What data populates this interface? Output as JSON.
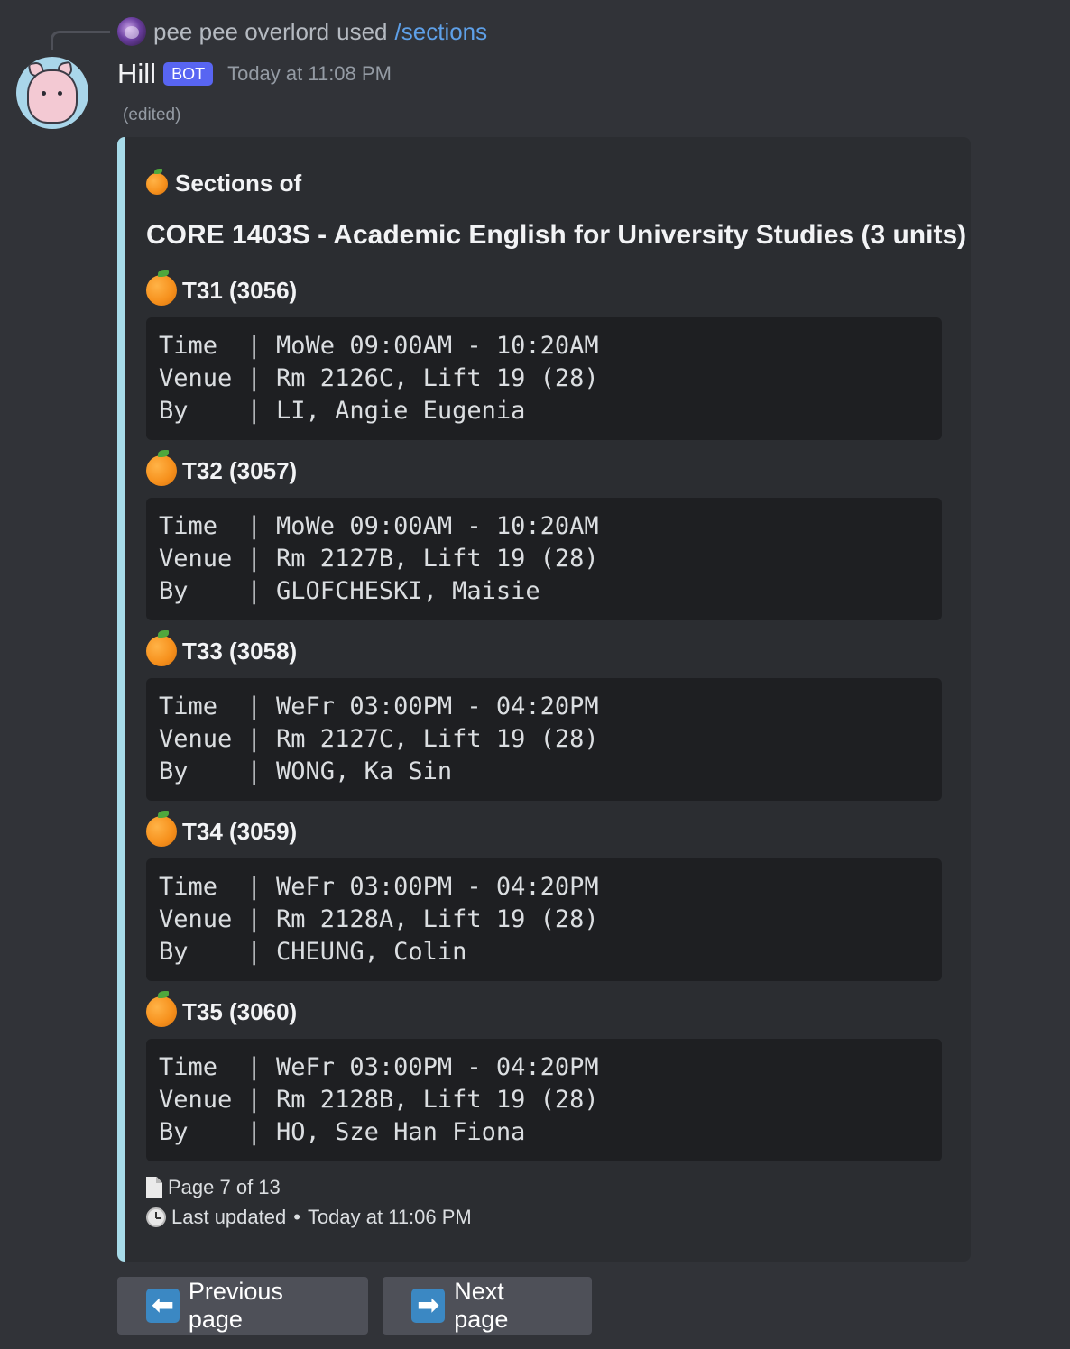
{
  "reply": {
    "user": "pee pee overlord",
    "used_text": "used",
    "command": "/sections"
  },
  "message": {
    "username": "Hill",
    "bot_tag": "BOT",
    "timestamp": "Today at 11:08 PM",
    "edited": "(edited)"
  },
  "embed": {
    "accent_color": "#a7dbe9",
    "title": "Sections of",
    "heading": "CORE 1403S - Academic English for University Studies (3 units)",
    "sections": [
      {
        "label": "T31 (3056)",
        "lines": [
          "Time  | MoWe 09:00AM - 10:20AM",
          "Venue | Rm 2126C, Lift 19 (28)",
          "By    | LI, Angie Eugenia"
        ]
      },
      {
        "label": "T32 (3057)",
        "lines": [
          "Time  | MoWe 09:00AM - 10:20AM",
          "Venue | Rm 2127B, Lift 19 (28)",
          "By    | GLOFCHESKI, Maisie"
        ]
      },
      {
        "label": "T33 (3058)",
        "lines": [
          "Time  | WeFr 03:00PM - 04:20PM",
          "Venue | Rm 2127C, Lift 19 (28)",
          "By    | WONG, Ka Sin"
        ]
      },
      {
        "label": "T34 (3059)",
        "lines": [
          "Time  | WeFr 03:00PM - 04:20PM",
          "Venue | Rm 2128A, Lift 19 (28)",
          "By    | CHEUNG, Colin"
        ]
      },
      {
        "label": "T35 (3060)",
        "lines": [
          "Time  | WeFr 03:00PM - 04:20PM",
          "Venue | Rm 2128B, Lift 19 (28)",
          "By    | HO, Sze Han Fiona"
        ]
      }
    ],
    "footer": {
      "page": "Page 7 of 13",
      "last_updated_label": "Last updated",
      "separator": "•",
      "last_updated_time": "Today at 11:06 PM"
    }
  },
  "buttons": {
    "previous": {
      "label": "Previous page",
      "icon": "arrow-left-icon",
      "glyph": "⬅"
    },
    "next": {
      "label": "Next page",
      "icon": "arrow-right-icon",
      "glyph": "➡"
    }
  },
  "colors": {
    "background": "#313338",
    "embed_bg": "#2b2d31",
    "code_bg": "#1e1f22",
    "bot_tag": "#5865f2",
    "command_link": "#5ea0e8",
    "button_bg": "#4e5058",
    "arrow_box": "#3b88c3"
  }
}
